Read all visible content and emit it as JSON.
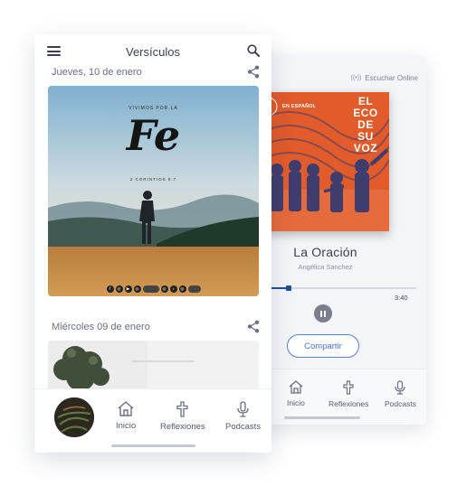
{
  "player": {
    "listen_online": "Escuchar Online",
    "album_tag": "EN ESPAÑOL",
    "album_title": [
      "EL",
      "ECO",
      "DE",
      "SU",
      "VOZ"
    ],
    "track_title": "La Oración",
    "track_artist": "Angélica Sanchez",
    "progress_fraction": 0.18,
    "duration": "3:40",
    "share_button": "Compartir",
    "nav": [
      "Inicio",
      "Reflexiones",
      "Podcasts"
    ]
  },
  "app": {
    "title": "Versículos",
    "entries": [
      {
        "date": "Jueves, 10 de enero",
        "kicker": "VIVIMOS POR LA",
        "word": "Fe",
        "reference": "2 CORINTIOS 5:7"
      },
      {
        "date": "Miércoles 09 de enero"
      }
    ],
    "nav": {
      "inicio": "Inicio",
      "reflexiones": "Reflexiones",
      "podcasts": "Podcasts"
    }
  },
  "colors": {
    "accent": "#4d72d0",
    "progress": "#1e4f9a",
    "album_bg": "#e25b2b",
    "album_ink": "#3e3d6e",
    "text_dark": "#3b3e52"
  },
  "icons": [
    "menu-icon",
    "search-icon",
    "share-icon",
    "headphones-icon",
    "pause-icon",
    "home-icon",
    "cross-icon",
    "microphone-icon"
  ]
}
